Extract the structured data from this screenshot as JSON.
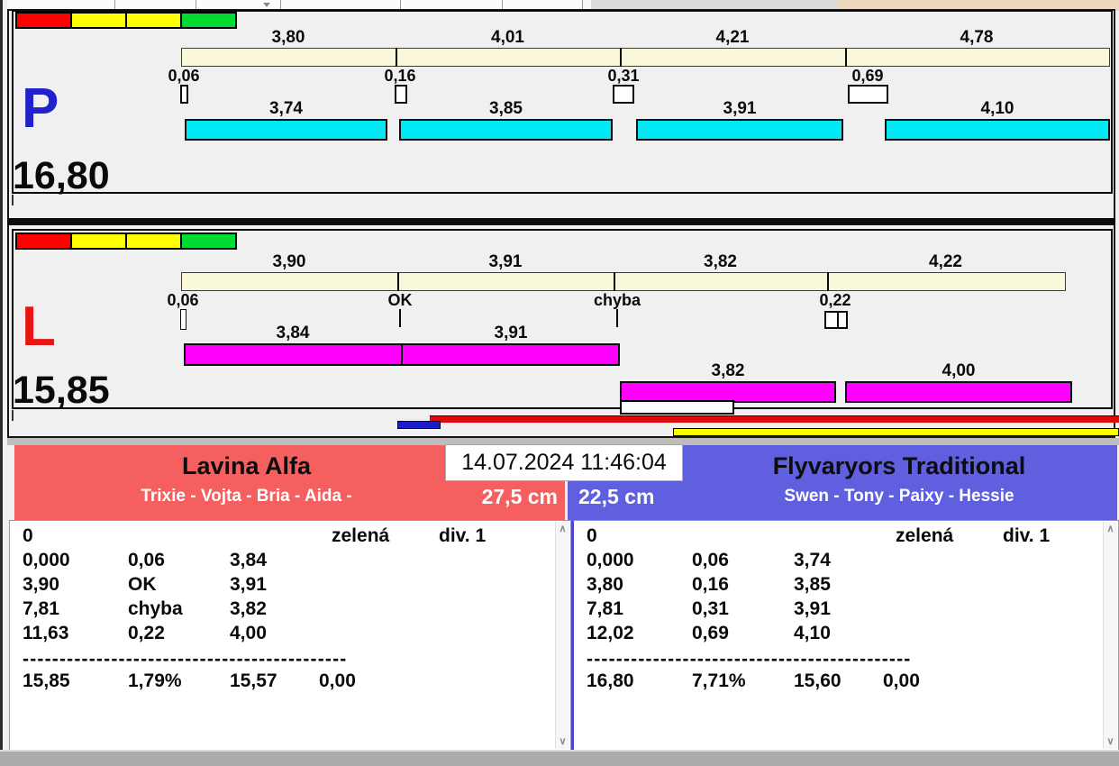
{
  "icons": {
    "scroll_up": "∧",
    "scroll_down": "∨",
    "dropdown": "▼"
  },
  "datetime": "14.07.2024 11:46:04",
  "lanes": {
    "P": {
      "label": "P",
      "total": "16,80",
      "splits": [
        "3,80",
        "4,01",
        "4,21",
        "4,78"
      ],
      "markers": [
        "0,06",
        "0,16",
        "0,31",
        "0,69"
      ],
      "legs": [
        "3,74",
        "3,85",
        "3,91",
        "4,10"
      ]
    },
    "L": {
      "label": "L",
      "total": "15,85",
      "splits": [
        "3,90",
        "3,91",
        "3,82",
        "4,22"
      ],
      "markers": [
        "0,06",
        "OK",
        "chyba",
        "0,22"
      ],
      "legs_row1": [
        "3,84",
        "3,91"
      ],
      "legs_row2": [
        "3,82",
        "4,00"
      ]
    }
  },
  "teams": {
    "left": {
      "name": "Lavina Alfa",
      "dogs": "Trixie - Vojta - Bria - Aida -",
      "height": "27,5 cm",
      "row0": [
        "0",
        "zelená",
        "div. 1"
      ],
      "rows": [
        [
          "0,000",
          "0,06",
          "3,84"
        ],
        [
          "3,90",
          "OK",
          "3,91"
        ],
        [
          "7,81",
          "chyba",
          "3,82"
        ],
        [
          "11,63",
          "0,22",
          "4,00"
        ]
      ],
      "dash": "--------------------------------------------",
      "totals": [
        "15,85",
        "1,79%",
        "15,57",
        "0,00"
      ]
    },
    "right": {
      "name": "Flyvaryors Traditional",
      "dogs": "Swen - Tony - Paixy - Hessie",
      "height": "22,5 cm",
      "row0": [
        "0",
        "zelená",
        "div. 1"
      ],
      "rows": [
        [
          "0,000",
          "0,06",
          "3,74"
        ],
        [
          "3,80",
          "0,16",
          "3,85"
        ],
        [
          "7,81",
          "0,31",
          "3,91"
        ],
        [
          "12,02",
          "0,69",
          "4,10"
        ]
      ],
      "dash": "--------------------------------------------",
      "totals": [
        "16,80",
        "7,71%",
        "15,60",
        "0,00"
      ]
    }
  },
  "colors": {
    "lane_p_letter": "#2222CC",
    "lane_l_letter": "#E81515",
    "team_left_bg": "#F55F5F",
    "team_right_bg": "#5F5FE0",
    "split_bar_fill": "#FAF8DA",
    "leg_bar_p_fill": "#00E9F5",
    "leg_bar_l_fill": "#FF00FF",
    "strip_colors": [
      "#FF0000",
      "#FFFF00",
      "#FFFF00",
      "#00DC32"
    ],
    "progress_red": "#DE0B0B",
    "progress_blue": "#1C1CC8",
    "progress_yellow": "#FFFF00",
    "topbar_tan": "#EFD9BE"
  }
}
